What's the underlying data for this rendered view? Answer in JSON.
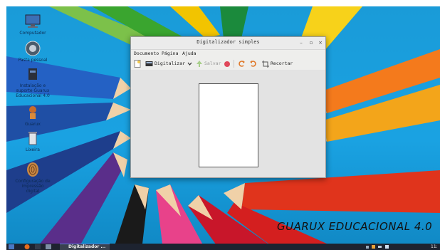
{
  "desktop": {
    "icons": [
      {
        "label": "Computador",
        "icon": "computer-icon"
      },
      {
        "label": "Pasta pessoal",
        "icon": "home-folder-icon"
      },
      {
        "label": "Instalação e\nsuporte Guarux\nEducacional 4.0",
        "icon": "tools-icon"
      },
      {
        "label": "Guarux",
        "icon": "mascot-icon"
      },
      {
        "label": "Lixeira",
        "icon": "trash-icon"
      },
      {
        "label": "Configuração de\nimpressão\ndigital",
        "icon": "fingerprint-icon"
      }
    ],
    "brand": "GUARUX EDUCACIONAL 4.0"
  },
  "window": {
    "title": "Digitalizador simples",
    "controls": {
      "minimize": "–",
      "maximize": "▫",
      "close": "×"
    },
    "menu": [
      "Documento",
      "Página",
      "Ajuda"
    ],
    "toolbar": {
      "scan_label": "Digitalizar",
      "save_label": "Salvar",
      "crop_label": "Recortar"
    }
  },
  "taskbar": {
    "task_label": "Digitalizador ...",
    "clock": "11:"
  },
  "colors": {
    "desktop_blue": "#1a9bd8",
    "window_bg": "#eeeeec",
    "taskbar": "#1d2330"
  }
}
